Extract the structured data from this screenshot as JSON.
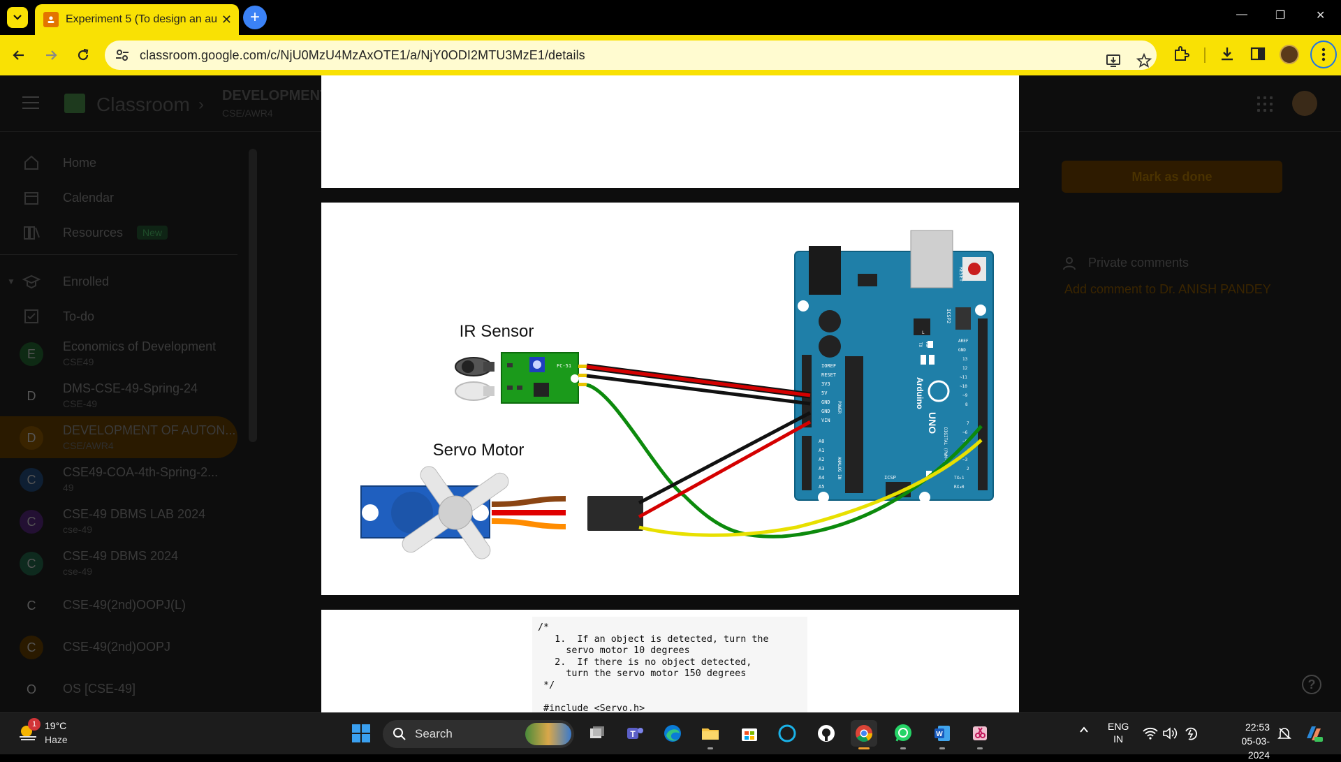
{
  "browser": {
    "tab_title": "Experiment 5 (To design an au",
    "url": "classroom.google.com/c/NjU0MzU4MzAxOTE1/a/NjY0ODI2MTU3MzE1/details"
  },
  "classroom": {
    "app_name": "Classroom",
    "course_title": "DEVELOPMENT",
    "course_section": "CSE/AWR4"
  },
  "sidebar": {
    "home": "Home",
    "calendar": "Calendar",
    "resources": "Resources",
    "new_badge": "New",
    "enrolled": "Enrolled",
    "todo": "To-do",
    "courses": [
      {
        "initial": "E",
        "name": "Economics of Development",
        "section": "CSE49",
        "color": "#0e2a14"
      },
      {
        "initial": "D",
        "name": "DMS-CSE-49-Spring-24",
        "section": "CSE-49",
        "color": "#0d0d0d"
      },
      {
        "initial": "D",
        "name": "DEVELOPMENT OF AUTON...",
        "section": "CSE/AWR4",
        "color": "#3a2400"
      },
      {
        "initial": "C",
        "name": "CSE49-COA-4th-Spring-2...",
        "section": "49",
        "color": "#0e1f33"
      },
      {
        "initial": "C",
        "name": "CSE-49 DBMS LAB 2024",
        "section": "cse-49",
        "color": "#231033"
      },
      {
        "initial": "C",
        "name": "CSE-49 DBMS 2024",
        "section": "cse-49",
        "color": "#0e2a1e"
      },
      {
        "initial": "C",
        "name": "CSE-49(2nd)OOPJ(L)",
        "section": "",
        "color": "#0d0d0d"
      },
      {
        "initial": "C",
        "name": "CSE-49(2nd)OOPJ",
        "section": "",
        "color": "#2a1a00"
      },
      {
        "initial": "O",
        "name": "OS [CSE-49]",
        "section": "",
        "color": "#0d0d0d"
      }
    ]
  },
  "right_panel": {
    "mark_done": "Mark as done",
    "private_comments": "Private comments",
    "add_comment": "Add comment to Dr. ANISH PANDEY"
  },
  "diagram": {
    "ir_label": "IR Sensor",
    "servo_label": "Servo Motor",
    "ir_chip_text": "FC-51",
    "ir_pins": "OUT GND VCC",
    "arduino_text": "Arduino",
    "uno_text": "UNO",
    "pin_labels_left": [
      "IOREF",
      "RESET",
      "3V3",
      "5V",
      "GND",
      "GND",
      "VIN"
    ],
    "analog_labels": [
      "A0",
      "A1",
      "A2",
      "A3",
      "A4",
      "A5"
    ],
    "digital_labels": [
      "AREF",
      "GND",
      "13",
      "12",
      "~11",
      "~10",
      "~9",
      "8",
      "7",
      "~6",
      "~5",
      "4",
      "~3",
      "2",
      "TX▸1",
      "RX◂0"
    ],
    "power_text": "POWER",
    "analog_in_text": "ANALOG IN",
    "digital_text": "DIGITAL (PWM~)",
    "icsp": "ICSP",
    "icsp2": "ICSP2",
    "reset": "RESET",
    "tx": "TX",
    "rx": "RX",
    "l": "L"
  },
  "code": {
    "lines": [
      "/*",
      "   1.  If an object is detected, turn the",
      "     servo motor 10 degrees",
      "   2.  If there is no object detected,",
      "     turn the servo motor 150 degrees",
      " */",
      "",
      " #include <Servo.h>"
    ]
  },
  "taskbar": {
    "temp": "19°C",
    "condition": "Haze",
    "weather_badge": "1",
    "search": "Search",
    "lang1": "ENG",
    "lang2": "IN",
    "time": "22:53",
    "date": "05-03-2024"
  }
}
